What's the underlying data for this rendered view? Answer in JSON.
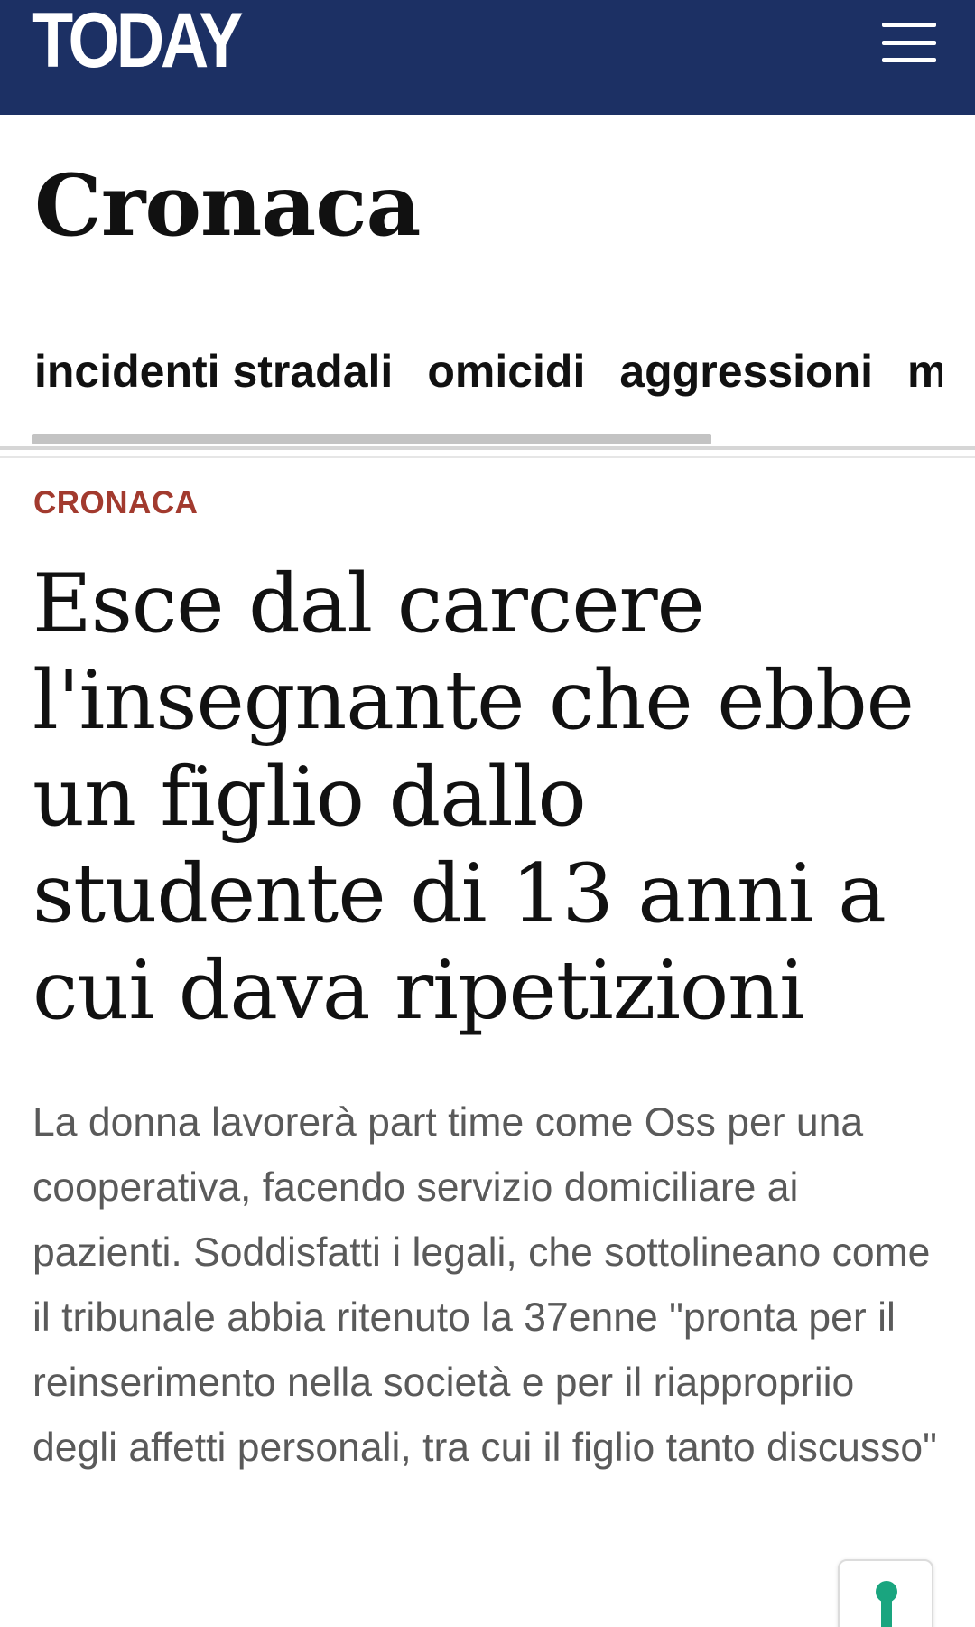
{
  "header": {
    "logo_text": "TODAY",
    "menu_icon": "hamburger-menu-icon",
    "background_color": "#1c3064"
  },
  "section": {
    "title": "Cronaca"
  },
  "subnav": {
    "items": [
      {
        "label": "incidenti stradali"
      },
      {
        "label": "omicidi"
      },
      {
        "label": "aggressioni"
      },
      {
        "label": "m"
      }
    ]
  },
  "article": {
    "category": "CRONACA",
    "category_color": "#a23a2e",
    "headline": "Esce dal carcere l'insegnante che ebbe un figlio dallo studente di 13 anni a cui dava ripetizioni",
    "summary": "La donna lavorerà part time come Oss per una cooperativa, facendo servizio domiciliare ai pazienti. Soddisfatti i legali, che sottolineano come il tribunale abbia ritenuto la 37enne \"pronta per il reinserimento nella società e per il riappropriio degli affetti personali, tra cui il figlio tanto discusso\""
  },
  "floating_button": {
    "icon": "accessibility-person-icon",
    "color": "#1aa57f"
  }
}
